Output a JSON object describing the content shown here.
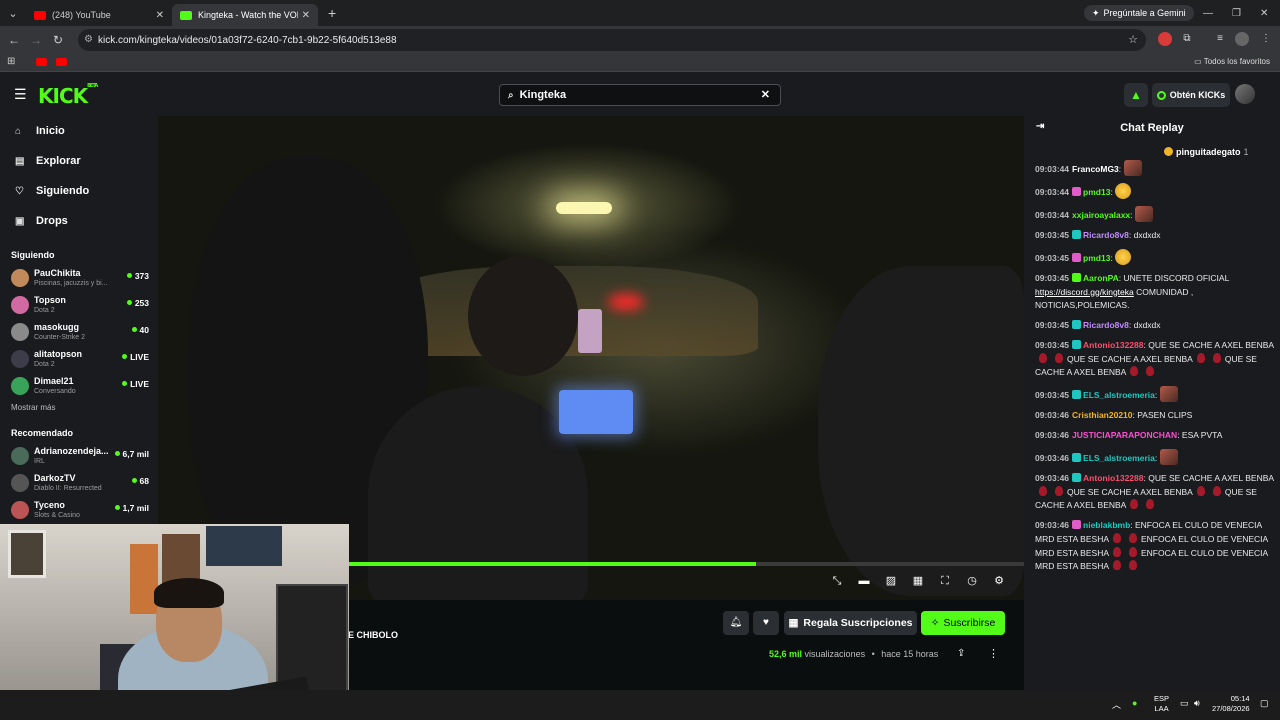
{
  "browser": {
    "tabs": [
      {
        "title": "(248) YouTube",
        "active": false
      },
      {
        "title": "Kingteka - Watch the VOD on K",
        "active": true
      }
    ],
    "new_tab": "+",
    "gemini_label": "Pregúntale a Gemini",
    "url": "kick.com/kingteka/videos/01a03f72-6240-7cb1-9b22-5f640d513e88",
    "bookmarks_all": "Todos los favoritos"
  },
  "header": {
    "logo": "KICK",
    "logo_beta": "BETA",
    "search_value": "Kingteka",
    "get_kicks": "Obtén KICKs"
  },
  "sidebar": {
    "nav": [
      {
        "label": "Inicio",
        "icon": "home-icon"
      },
      {
        "label": "Explorar",
        "icon": "browse-icon"
      },
      {
        "label": "Siguiendo",
        "icon": "heart-icon"
      },
      {
        "label": "Drops",
        "icon": "drops-icon"
      }
    ],
    "following_title": "Siguiendo",
    "following": [
      {
        "name": "PauChikita",
        "sub": "Piscinas, jacuzzis y bi...",
        "viewers": "373",
        "color": "#c08a5a"
      },
      {
        "name": "Topson",
        "sub": "Dota 2",
        "viewers": "253",
        "color": "#d06aa0"
      },
      {
        "name": "masokugg",
        "sub": "Counter-Strike 2",
        "viewers": "40",
        "color": "#8a8a8a"
      },
      {
        "name": "alitatopson",
        "sub": "Dota 2",
        "viewers": "LIVE",
        "color": "#3d3d4a"
      },
      {
        "name": "Dimael21",
        "sub": "Conversando",
        "viewers": "LIVE",
        "color": "#3aa35a"
      }
    ],
    "show_more": "Mostrar más",
    "recommended_title": "Recomendado",
    "recommended": [
      {
        "name": "Adrianozendeja...",
        "sub": "IRL",
        "viewers": "6,7 mil",
        "color": "#4a6a5a"
      },
      {
        "name": "DarkozTV",
        "sub": "Diablo II: Resurrected",
        "viewers": "68",
        "color": "#555"
      },
      {
        "name": "Tyceno",
        "sub": "Slots & Casino",
        "viewers": "1,7 mil",
        "color": "#b55"
      }
    ]
  },
  "player": {
    "progress": 0.69,
    "controls": [
      "theater-icon",
      "clip-icon",
      "mini-player-icon",
      "cc-icon",
      "fullscreen-icon",
      "speed-icon",
      "settings-icon"
    ]
  },
  "info": {
    "title_fragment": "E CHIBOLO",
    "gift_label": "Regala Suscripciones",
    "subscribe_label": "Suscribirse",
    "views": "52,6 mil",
    "views_word": "visualizaciones",
    "bullet": "•",
    "ago": "hace 15 horas"
  },
  "chat": {
    "title": "Chat Replay",
    "pinned_user": "pinguitadegato",
    "pinned_count": "1",
    "messages": [
      {
        "time": "09:03:44",
        "user": "FrancoMG3",
        "color": "#ffffff",
        "badge": "",
        "text": ":",
        "emote": "img"
      },
      {
        "time": "09:03:44",
        "user": "pmd13",
        "color": "#53fc18",
        "badge": "#e05cc8",
        "text": ":",
        "emote": "smile"
      },
      {
        "time": "09:03:44",
        "user": "xxjairoayalaxx",
        "color": "#53fc18",
        "badge": "",
        "text": ":",
        "emote": "img"
      },
      {
        "time": "09:03:45",
        "user": "Ricardo8v8",
        "color": "#c08cff",
        "badge": "#1fc7c0",
        "text": ": dxdxdx",
        "emote": ""
      },
      {
        "time": "09:03:45",
        "user": "pmd13",
        "color": "#53fc18",
        "badge": "#e05cc8",
        "text": ":",
        "emote": "smile"
      },
      {
        "time": "09:03:45",
        "user": "AaronPA",
        "color": "#53fc18",
        "badge": "#53fc18",
        "text": ": UNETE DISCORD OFICIAL",
        "link": "https://discord.gg/kingteka",
        "text2": " COMUNIDAD , NOTICIAS,POLEMICAS.",
        "emote": ""
      },
      {
        "time": "09:03:45",
        "user": "Ricardo8v8",
        "color": "#c08cff",
        "badge": "#1fc7c0",
        "text": ": dxdxdx",
        "emote": ""
      },
      {
        "time": "09:03:45",
        "user": "Antonio132288",
        "color": "#ff4d6d",
        "badge": "#1fc7c0",
        "text": ": QUE SE CACHE A AXEL BENBA",
        "repeat": "QUE SE CACHE A AXEL BENBA",
        "drops": true
      },
      {
        "time": "09:03:45",
        "user": "ELS_alstroemeria",
        "color": "#1fc7c0",
        "badge": "#1fc7c0",
        "text": ":",
        "emote": "img"
      },
      {
        "time": "09:03:46",
        "user": "Cristhian20210",
        "color": "#f0b429",
        "badge": "",
        "text": ": PASEN CLIPS",
        "emote": ""
      },
      {
        "time": "09:03:46",
        "user": "JUSTICIAPARAPONCHAN",
        "color": "#ff4dd2",
        "badge": "",
        "text": ": ESA PVTA",
        "emote": ""
      },
      {
        "time": "09:03:46",
        "user": "ELS_alstroemeria",
        "color": "#1fc7c0",
        "badge": "#1fc7c0",
        "text": ":",
        "emote": "img"
      },
      {
        "time": "09:03:46",
        "user": "Antonio132288",
        "color": "#ff4d6d",
        "badge": "#1fc7c0",
        "text": ": QUE SE CACHE A AXEL BENBA",
        "repeat": "QUE SE CACHE A AXEL BENBA",
        "drops": true
      },
      {
        "time": "09:03:46",
        "user": "nieblakbmb",
        "color": "#1fc7c0",
        "badge": "#e05cc8",
        "text": ": ENFOCA EL CULO DE VENECIA MRD ESTA BESHA",
        "repeat": "ENFOCA EL CULO DE VENECIA MRD ESTA BESHA",
        "drops": true
      }
    ]
  },
  "taskbar": {
    "lang1": "ESP",
    "lang2": "LAA",
    "time": "05:14",
    "date": "27/08/2026"
  },
  "colors": {
    "accent": "#53fc18",
    "bg": "#0b0e0f",
    "panel": "#191b1f"
  }
}
